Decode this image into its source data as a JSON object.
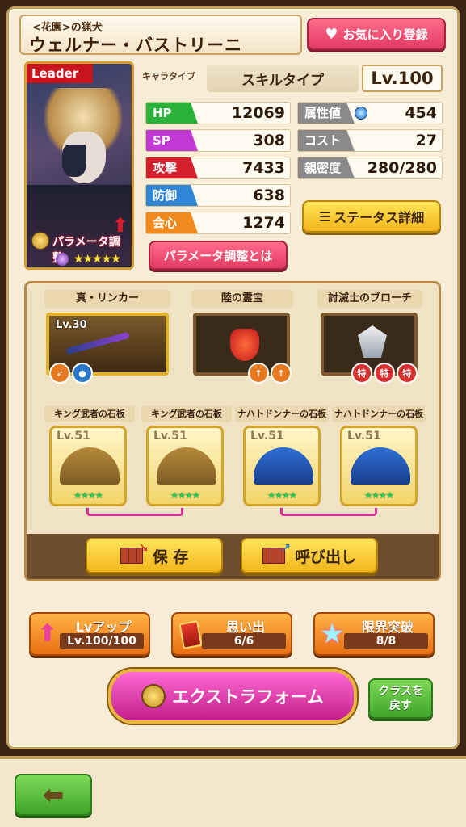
{
  "character": {
    "subtitle": "<花園>の猟犬",
    "name": "ウェルナー・バストリーニ",
    "leader_tag": "Leader",
    "param_label": "パラメータ調整",
    "rarity_stars": "★★★★★",
    "type_label": "キャラタイプ",
    "type_value": "スキルタイプ",
    "level": "Lv.100"
  },
  "favorite_button": "お気に入り登録",
  "stats": {
    "hp": {
      "label": "HP",
      "value": "12069"
    },
    "sp": {
      "label": "SP",
      "value": "308"
    },
    "atk": {
      "label": "攻撃",
      "value": "7433"
    },
    "def": {
      "label": "防御",
      "value": "638"
    },
    "crit": {
      "label": "会心",
      "value": "1274"
    },
    "attr": {
      "label": "属性値",
      "value": "454"
    },
    "cost": {
      "label": "コスト",
      "value": "27"
    },
    "affinity": {
      "label": "親密度",
      "value": "280/280"
    }
  },
  "status_detail_button": "ステータス詳細",
  "param_adjust_button": "パラメータ調整とは",
  "equipment": {
    "weapon": {
      "title": "真・リンカー",
      "level": "Lv.30"
    },
    "treasure": {
      "title": "陸の霊宝"
    },
    "accessory": {
      "title": "討滅士のブローチ"
    },
    "slabs": [
      {
        "title": "キング武者の石板",
        "level": "Lv.51",
        "stars": "★★★★"
      },
      {
        "title": "キング武者の石板",
        "level": "Lv.51",
        "stars": "★★★★"
      },
      {
        "title": "ナハトドンナーの石板",
        "level": "Lv.51",
        "stars": "★★★★"
      },
      {
        "title": "ナハトドンナーの石板",
        "level": "Lv.51",
        "stars": "★★★★"
      }
    ]
  },
  "save_button": "保 存",
  "load_button": "呼び出し",
  "lvup": {
    "title": "Lvアップ",
    "value": "Lv.100/100"
  },
  "memory": {
    "title": "思い出",
    "value": "6/6"
  },
  "limit_break": {
    "title": "限界突破",
    "value": "8/8"
  },
  "extra_form_button": "エクストラフォーム",
  "class_return_button": {
    "line1": "クラスを",
    "line2": "戻す"
  },
  "special_badge": "特"
}
